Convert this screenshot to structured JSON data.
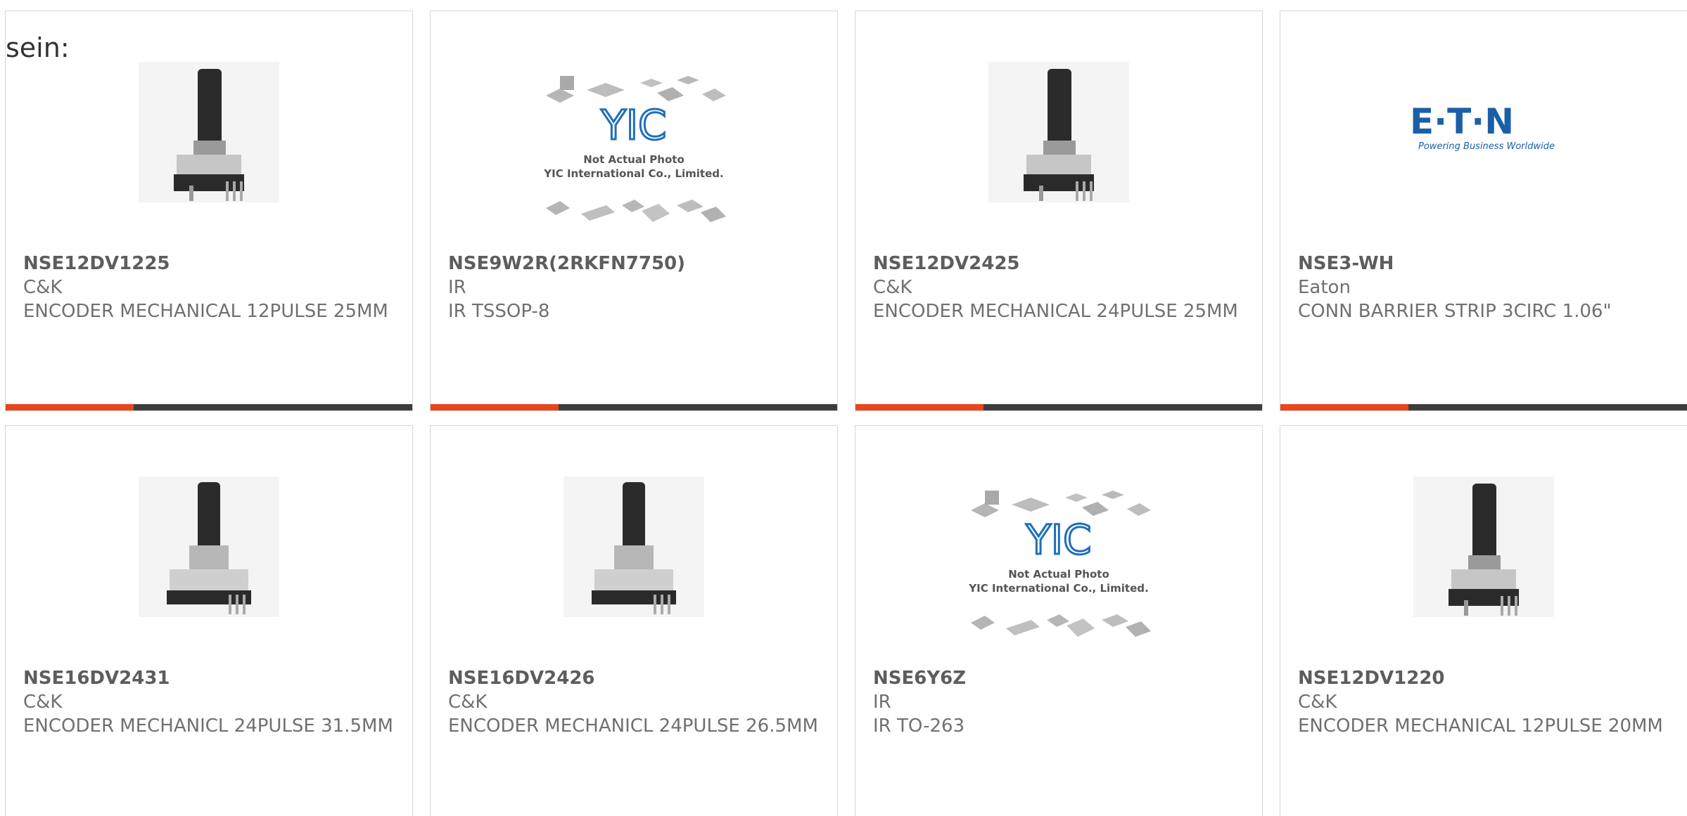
{
  "intro_text": "sein:",
  "products": [
    {
      "part": "NSE12DV1225",
      "mfr": "C&K",
      "desc": "ENCODER MECHANICAL 12PULSE 25MM",
      "image": "encoder-image"
    },
    {
      "part": "NSE9W2R(2RKFN7750)",
      "mfr": "IR",
      "desc": "IR TSSOP-8",
      "image": "not-actual-photo-image",
      "placeholder": {
        "brand": "YIC",
        "line1": "Not Actual Photo",
        "line2": "YIC International Co., Limited."
      }
    },
    {
      "part": "NSE12DV2425",
      "mfr": "C&K",
      "desc": "ENCODER MECHANICAL 24PULSE 25MM",
      "image": "encoder-image"
    },
    {
      "part": "NSE3-WH",
      "mfr": "Eaton",
      "desc": "CONN BARRIER STRIP 3CIRC 1.06\"",
      "image": "eaton-logo",
      "logo": {
        "name": "E·T·N",
        "tagline": "Powering Business Worldwide"
      }
    },
    {
      "part": "NSE16DV2431",
      "mfr": "C&K",
      "desc": "ENCODER MECHANICL 24PULSE 31.5MM",
      "image": "encoder-image"
    },
    {
      "part": "NSE16DV2426",
      "mfr": "C&K",
      "desc": "ENCODER MECHANICL 24PULSE 26.5MM",
      "image": "encoder-image"
    },
    {
      "part": "NSE6Y6Z",
      "mfr": "IR",
      "desc": "IR TO-263",
      "image": "not-actual-photo-image",
      "placeholder": {
        "brand": "YIC",
        "line1": "Not Actual Photo",
        "line2": "YIC International Co., Limited."
      }
    },
    {
      "part": "NSE12DV1220",
      "mfr": "C&K",
      "desc": "ENCODER MECHANICAL 12PULSE 20MM",
      "image": "encoder-image"
    }
  ],
  "colors": {
    "accent": "#e8461c",
    "bar": "#3d3d3d",
    "eaton_blue": "#1b5fa8",
    "yic_blue": "#1f6fb8"
  }
}
